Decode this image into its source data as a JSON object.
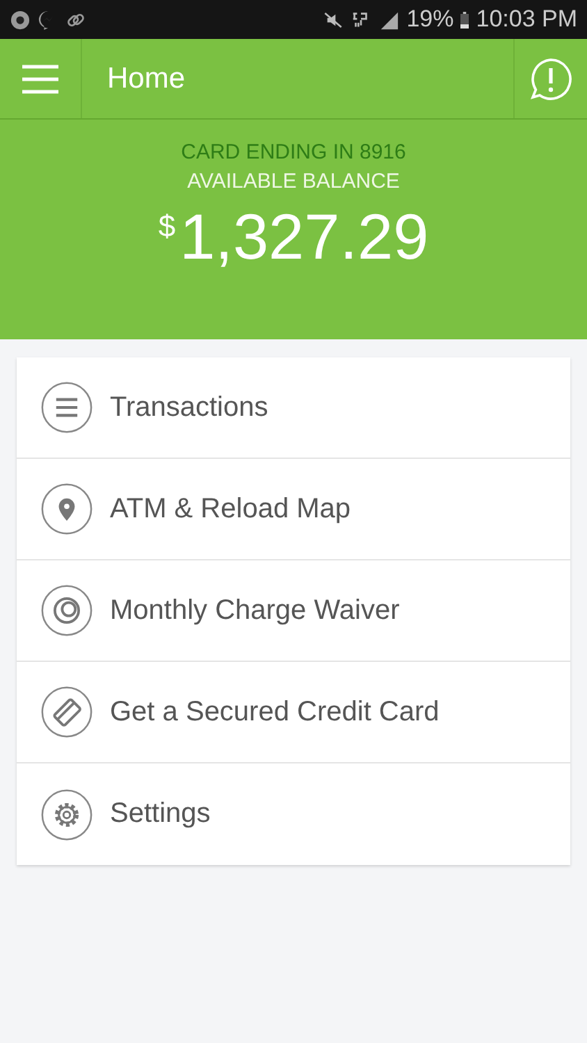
{
  "status_bar": {
    "battery": "19%",
    "time": "10:03 PM"
  },
  "header": {
    "title": "Home"
  },
  "balance": {
    "card_label": "CARD ENDING IN 8916",
    "label": "AVAILABLE BALANCE",
    "currency": "$",
    "amount": "1,327.29"
  },
  "menu": [
    {
      "kind": "list",
      "label": "Transactions"
    },
    {
      "kind": "pin",
      "label": "ATM & Reload Map"
    },
    {
      "kind": "ring",
      "label": "Monthly Charge Waiver"
    },
    {
      "kind": "card",
      "label": "Get a Secured Credit Card"
    },
    {
      "kind": "gear",
      "label": "Settings"
    }
  ]
}
